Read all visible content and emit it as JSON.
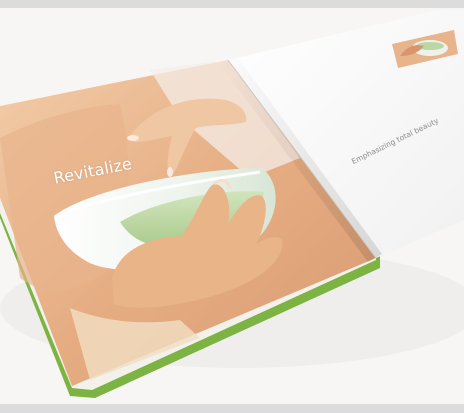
{
  "brochure": {
    "left_page": {
      "headline": "Revitalize"
    },
    "right_page": {
      "tagline": "Emphasizing total beauty"
    }
  },
  "colors": {
    "background": "#f7f6f4",
    "frame": "#dcdcdc",
    "cover_green": "#7cb342",
    "skin": "#e9b58c"
  }
}
